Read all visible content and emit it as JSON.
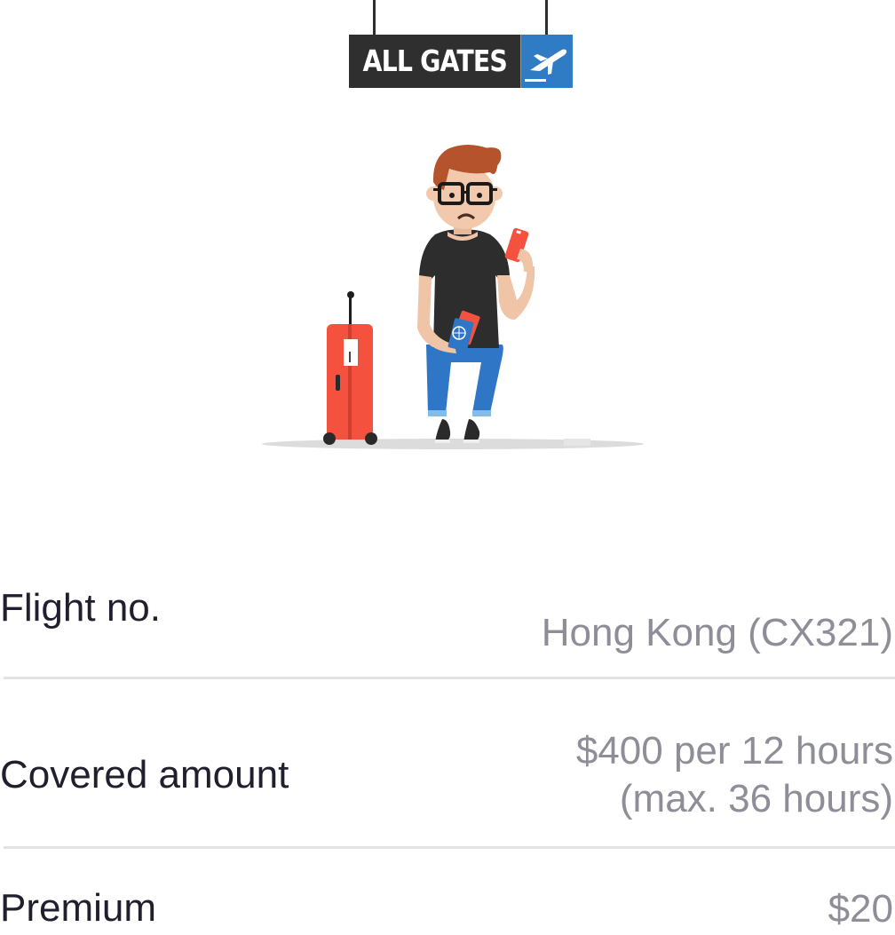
{
  "sign": {
    "text": "ALL GATES"
  },
  "illustration": {
    "subject": "traveler waiting with suitcase and phone",
    "icons": [
      "airplane-icon",
      "suitcase-icon",
      "phone-icon",
      "passport-icon"
    ]
  },
  "details": [
    {
      "label": "Flight no.",
      "value": "Hong Kong (CX321)"
    },
    {
      "label": "Covered amount",
      "value_line1": "$400 per 12 hours",
      "value_line2": "(max. 36 hours)"
    },
    {
      "label": "Premium",
      "value": "$20"
    }
  ],
  "colors": {
    "label": "#1f1f2e",
    "value": "#8e8e98",
    "divider": "#e3e3e6",
    "sign_dark": "#2f2f30",
    "sign_blue": "#2f7bc4",
    "suitcase": "#f5513f"
  }
}
